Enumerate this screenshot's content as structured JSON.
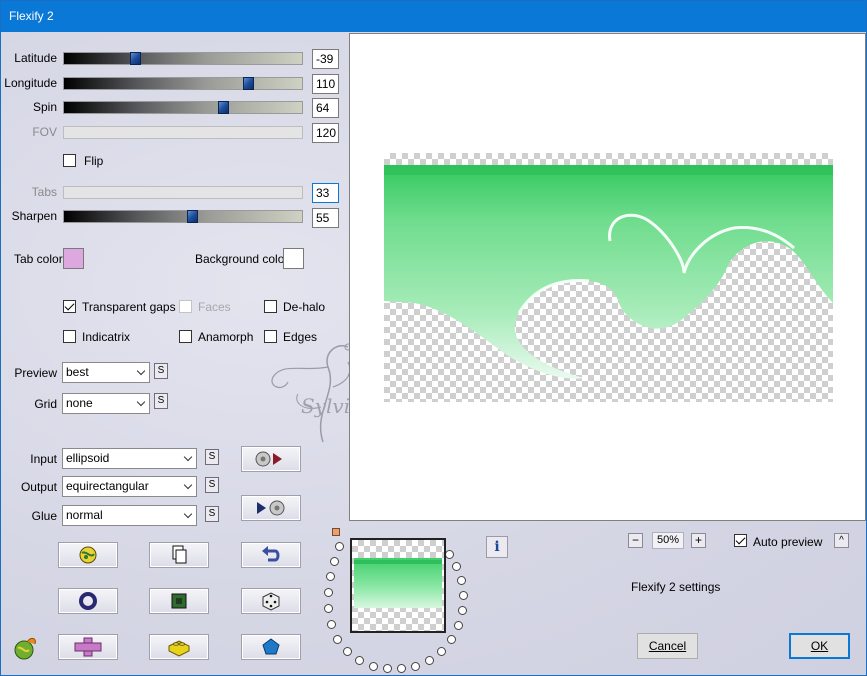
{
  "window": {
    "title": "Flexify 2"
  },
  "sliders": {
    "latitude": {
      "label": "Latitude",
      "value": "-39",
      "fraction": 0.29,
      "enabled": true
    },
    "longitude": {
      "label": "Longitude",
      "value": "110",
      "fraction": 0.79,
      "enabled": true
    },
    "spin": {
      "label": "Spin",
      "value": "64",
      "fraction": 0.68,
      "enabled": true
    },
    "fov": {
      "label": "FOV",
      "value": "120",
      "enabled": false
    },
    "tabs": {
      "label": "Tabs",
      "value": "33",
      "enabled": false
    },
    "sharpen": {
      "label": "Sharpen",
      "value": "55",
      "fraction": 0.54,
      "enabled": true
    }
  },
  "flip": {
    "label": "Flip",
    "checked": false
  },
  "colors": {
    "tab_label": "Tab color",
    "tab_color": "#dda8dd",
    "bg_label": "Background color",
    "bg_color": "#ffffff"
  },
  "options": {
    "transparent_gaps": {
      "label": "Transparent gaps",
      "checked": true
    },
    "faces": {
      "label": "Faces",
      "checked": false,
      "enabled": false
    },
    "de_halo": {
      "label": "De-halo",
      "checked": false
    },
    "indicatrix": {
      "label": "Indicatrix",
      "checked": false
    },
    "anamorph": {
      "label": "Anamorph",
      "checked": false
    },
    "edges": {
      "label": "Edges",
      "checked": false
    }
  },
  "preview_select": {
    "label": "Preview",
    "value": "best"
  },
  "grid_select": {
    "label": "Grid",
    "value": "none"
  },
  "input_select": {
    "label": "Input",
    "value": "ellipsoid"
  },
  "output_select": {
    "label": "Output",
    "value": "equirectangular"
  },
  "glue_select": {
    "label": "Glue",
    "value": "normal"
  },
  "s_button_label": "S",
  "watermark": "Sylviane",
  "zoom": {
    "value": "50%",
    "minus": "−",
    "plus": "+"
  },
  "auto_preview": {
    "label": "Auto preview",
    "checked": true,
    "collapse_glyph": "^"
  },
  "settings_label": "Flexify 2 settings",
  "buttons": {
    "cancel": "Cancel",
    "ok": "OK",
    "info": "i"
  },
  "accent_colors": {
    "titlebar": "#0a78d7",
    "preview_green": "#4fd67a"
  },
  "icons": [
    "convert-to-sphere-icon",
    "convert-from-sphere-icon",
    "randomize-globe-icon",
    "copy-icon",
    "undo-icon",
    "ring-icon",
    "chip-icon",
    "dice-icon",
    "flexify-logo-icon",
    "cross-shape-icon",
    "lego-brick-icon",
    "pentagon-icon"
  ]
}
